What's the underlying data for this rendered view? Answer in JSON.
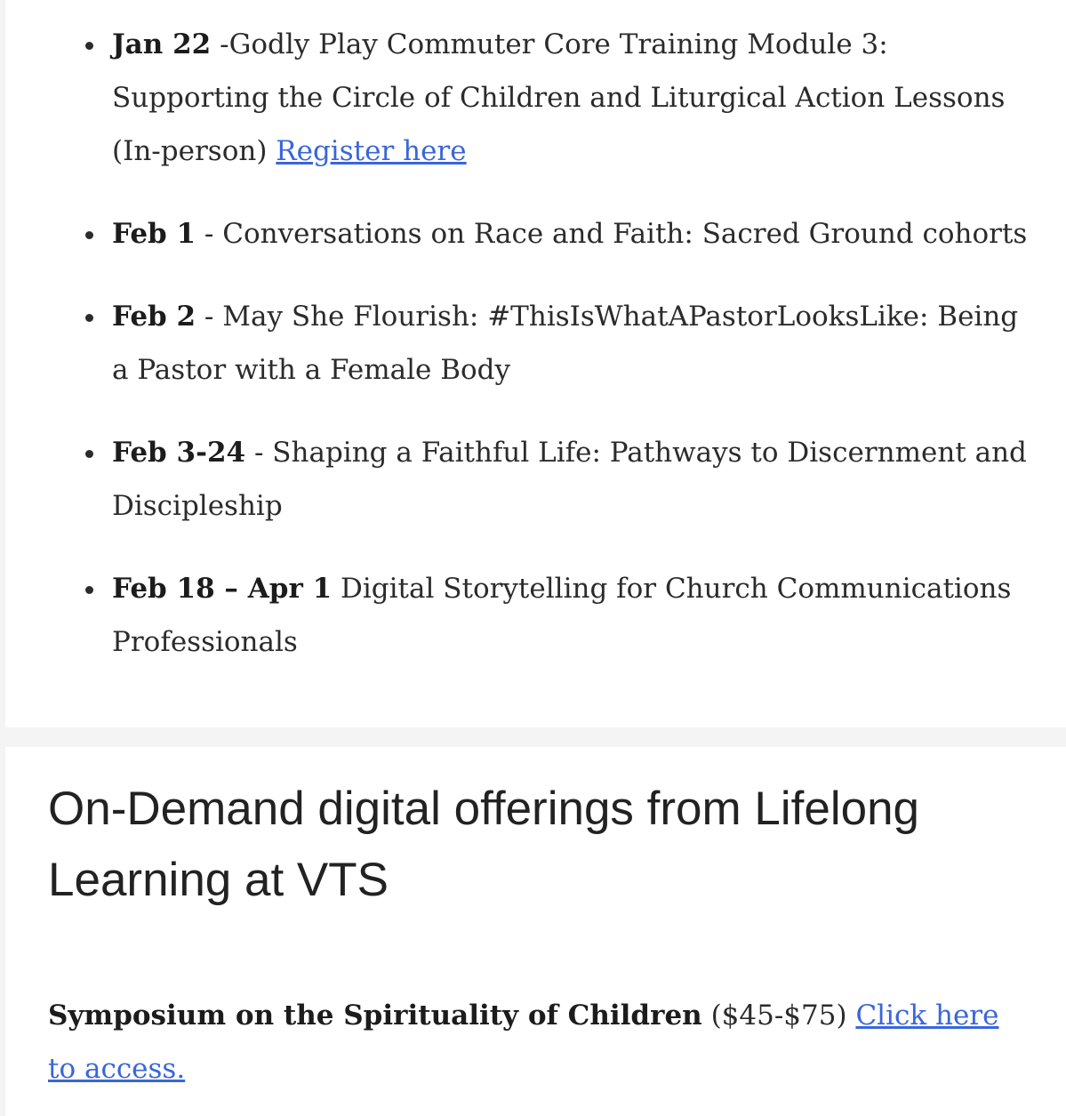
{
  "events": [
    {
      "date": "Jan 22",
      "text": " -Godly Play Commuter Core Training Module 3: Supporting the Circle of Children and Liturgical Action Lessons (In-person) ",
      "link": "Register here"
    },
    {
      "date": "Feb 1",
      "text": " - Conversations on Race and Faith: Sacred Ground cohorts"
    },
    {
      "date": "Feb 2",
      "text": " - May She Flourish:  #ThisIsWhatAPastorLooksLike: Being a Pastor with a Female Body"
    },
    {
      "date": "Feb 3-24",
      "text": " - Shaping a Faithful Life: Pathways to Discernment and Discipleship"
    },
    {
      "date": "Feb 18 – Apr 1",
      "text": " Digital Storytelling for Church Communications Professionals"
    }
  ],
  "ondemand": {
    "title": "On-Demand digital offerings from Lifelong Learning at VTS",
    "offering": {
      "name": "Symposium on the Spirituality of Children",
      "price": " ($45-$75)  ",
      "link": "Click here to access."
    }
  },
  "colors": {
    "link": "#3a66d9",
    "text": "#2b2b2b",
    "background": "#f4f4f4"
  }
}
